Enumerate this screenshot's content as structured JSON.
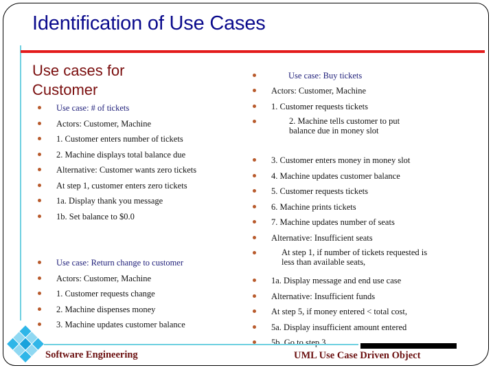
{
  "slide": {
    "title": "Identification of Use Cases",
    "section_heading_line1": "Use cases for",
    "section_heading_line2": "Customer",
    "left_column_1": [
      {
        "text": "Use case: # of tickets",
        "highlight": true
      },
      {
        "text": "Actors: Customer, Machine"
      },
      {
        "text": "1. Customer enters number of tickets"
      },
      {
        "text": "2. Machine displays total balance due"
      },
      {
        "text": "Alternative: Customer wants zero tickets"
      },
      {
        "text": "At step 1, customer enters zero tickets"
      },
      {
        "text": "1a. Display thank you message"
      },
      {
        "text": "1b. Set balance to $0.0"
      }
    ],
    "left_column_2": [
      {
        "text": "Use case: Return change to customer",
        "highlight": true
      },
      {
        "text": "Actors: Customer, Machine"
      },
      {
        "text": "1. Customer requests change"
      },
      {
        "text": "2. Machine dispenses money"
      },
      {
        "text": "3. Machine updates customer balance"
      }
    ],
    "right_column": [
      {
        "text": "Use case: Buy tickets",
        "highlight": true
      },
      {
        "text": "Actors: Customer, Machine"
      },
      {
        "text": "1. Customer requests tickets"
      },
      {
        "text": "2. Machine tells customer to put balance due in money slot"
      },
      {
        "text": "3. Customer enters money in money slot"
      },
      {
        "text": "4. Machine updates customer balance"
      },
      {
        "text": "5. Customer requests tickets"
      },
      {
        "text": "6. Machine prints tickets"
      },
      {
        "text": "7. Machine updates number of seats"
      },
      {
        "text": "Alternative: Insufficient seats"
      },
      {
        "text": "At step 1, if number of tickets requested is less than available seats,"
      },
      {
        "text": "1a. Display message and end use case"
      },
      {
        "text": "Alternative: Insufficient funds"
      },
      {
        "text": "At step 5, if money entered < total cost,"
      },
      {
        "text": "5a. Display insufficient amount entered"
      },
      {
        "text": "5b. Go to step 3"
      }
    ],
    "footer_left": "Software Engineering",
    "footer_right": "UML Use Case Driven Object"
  },
  "colors": {
    "title": "#0a0a8c",
    "heading": "#7a0e0e",
    "rule": "#e31b1b",
    "bullet": "#b85a2c",
    "accent_cyan": "#6fd0e0",
    "footer": "#6b1010"
  }
}
